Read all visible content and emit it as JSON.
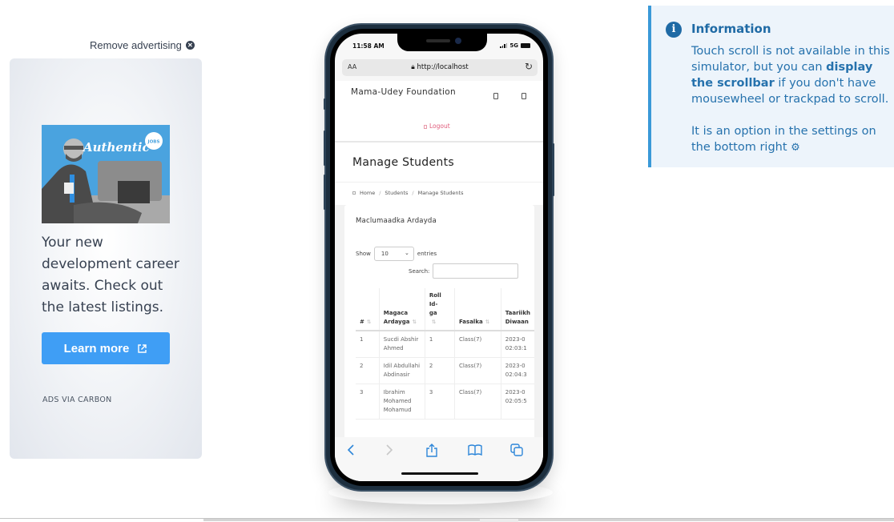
{
  "ad": {
    "remove_label": "Remove advertising",
    "image_text": "Authentic",
    "image_badge": "JOBS",
    "body": "Your new development career awaits. Check out the latest listings.",
    "button_label": "Learn more",
    "footer": "ADS VIA CARBON"
  },
  "info": {
    "title": "Information",
    "p1_a": "Touch scroll is not available in this simulator, but you can ",
    "p1_bold": "display the scrollbar",
    "p1_b": " if you don't have mousewheel or trackpad to scroll.",
    "p2": "It is an option in the settings on the bottom right"
  },
  "phone": {
    "status": {
      "time": "11:58 AM",
      "network": "5G"
    },
    "browser": {
      "aa": "AA",
      "url": "http://localhost"
    },
    "app": {
      "brand": "Mama-Udey Foundation",
      "logout": "Logout",
      "page_title": "Manage Students",
      "breadcrumb": [
        "Home",
        "Students",
        "Manage Students"
      ],
      "card_title": "Maclumaadka Ardayda",
      "show_label": "Show",
      "entries_value": "10",
      "entries_label": "entries",
      "search_label": "Search:",
      "search_value": "",
      "table": {
        "headers": [
          "#",
          "Magaca Ardayga",
          "Roll Id-ga",
          "Fasalka",
          "Taariikh Diwaan"
        ],
        "rows": [
          {
            "num": "1",
            "name": "Sucdi Abshir Ahmed",
            "roll": "1",
            "class": "Class(7)",
            "date": "2023-0",
            "time": "02:03:1"
          },
          {
            "num": "2",
            "name": "Idil Abdullahi Abdinasir",
            "roll": "2",
            "class": "Class(7)",
            "date": "2023-0",
            "time": "02:04:3"
          },
          {
            "num": "3",
            "name": "Ibrahim Mohamed Mohamud",
            "roll": "3",
            "class": "Class(7)",
            "date": "2023-0",
            "time": "02:05:5"
          }
        ]
      }
    }
  }
}
